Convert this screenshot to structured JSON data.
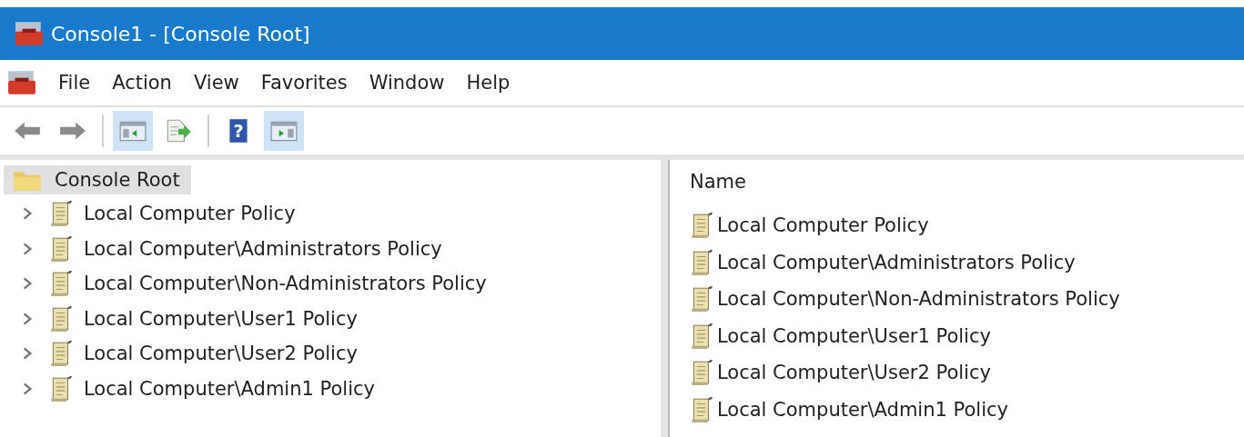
{
  "window": {
    "title": "Console1 - [Console Root]"
  },
  "menu": [
    "File",
    "Action",
    "View",
    "Favorites",
    "Window",
    "Help"
  ],
  "toolbar": [
    {
      "kind": "back",
      "pressed": false
    },
    {
      "kind": "forward",
      "pressed": false
    },
    {
      "kind": "tree",
      "pressed": true
    },
    {
      "kind": "export",
      "pressed": false
    },
    {
      "kind": "help",
      "pressed": false,
      "label": "?"
    },
    {
      "kind": "actions",
      "pressed": true
    }
  ],
  "tree": {
    "label": "Console Root",
    "selected": true,
    "children": [
      {
        "label": "Local Computer Policy",
        "expanded": false
      },
      {
        "label": "Local Computer\\Administrators Policy",
        "expanded": false
      },
      {
        "label": "Local Computer\\Non-Administrators Policy",
        "expanded": false
      },
      {
        "label": "Local Computer\\User1 Policy",
        "expanded": false
      },
      {
        "label": "Local Computer\\User2 Policy",
        "expanded": false
      },
      {
        "label": "Local Computer\\Admin1 Policy",
        "expanded": false
      }
    ]
  },
  "list": {
    "columns": [
      "Name"
    ],
    "rows": [
      "Local Computer Policy",
      "Local Computer\\Administrators Policy",
      "Local Computer\\Non-Administrators Policy",
      "Local Computer\\User1 Policy",
      "Local Computer\\User2 Policy",
      "Local Computer\\Admin1 Policy"
    ]
  }
}
